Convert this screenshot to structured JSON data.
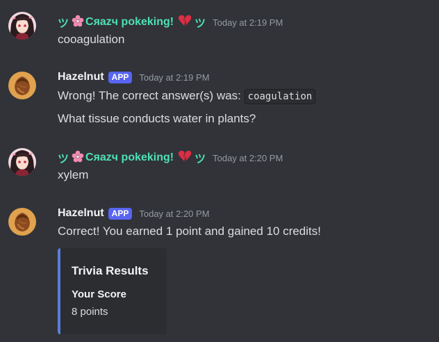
{
  "messages": [
    {
      "author": {
        "prefix": "ツ",
        "name": "Cяazч pokeking!",
        "suffix": "ツ",
        "flower_icon": "cherry-blossom-icon",
        "heart_icon": "broken-heart-icon"
      },
      "timestamp": "Today at 2:19 PM",
      "text": "cooagulation"
    },
    {
      "author": {
        "name": "Hazelnut",
        "tag": "APP",
        "avatar_icon": "hazelnut-icon"
      },
      "timestamp": "Today at 2:19 PM",
      "text_prefix": "Wrong! The correct answer(s) was:",
      "code": "coagulation",
      "question": "What tissue conducts water in plants?"
    },
    {
      "author": {
        "prefix": "ツ",
        "name": "Cяazч pokeking!",
        "suffix": "ツ",
        "flower_icon": "cherry-blossom-icon",
        "heart_icon": "broken-heart-icon"
      },
      "timestamp": "Today at 2:20 PM",
      "text": "xylem"
    },
    {
      "author": {
        "name": "Hazelnut",
        "tag": "APP",
        "avatar_icon": "hazelnut-icon"
      },
      "timestamp": "Today at 2:20 PM",
      "text": "Correct! You earned 1 point and gained 10 credits!",
      "embed": {
        "title": "Trivia Results",
        "field_name": "Your Score",
        "field_value": "8 points",
        "accent_color": "#5c7dd8"
      }
    }
  ],
  "colors": {
    "background": "#313338",
    "user_name": "#4ee1b6",
    "app_tag": "#5865f2",
    "timestamp": "#949ba4",
    "embed_background": "#2b2d31"
  }
}
